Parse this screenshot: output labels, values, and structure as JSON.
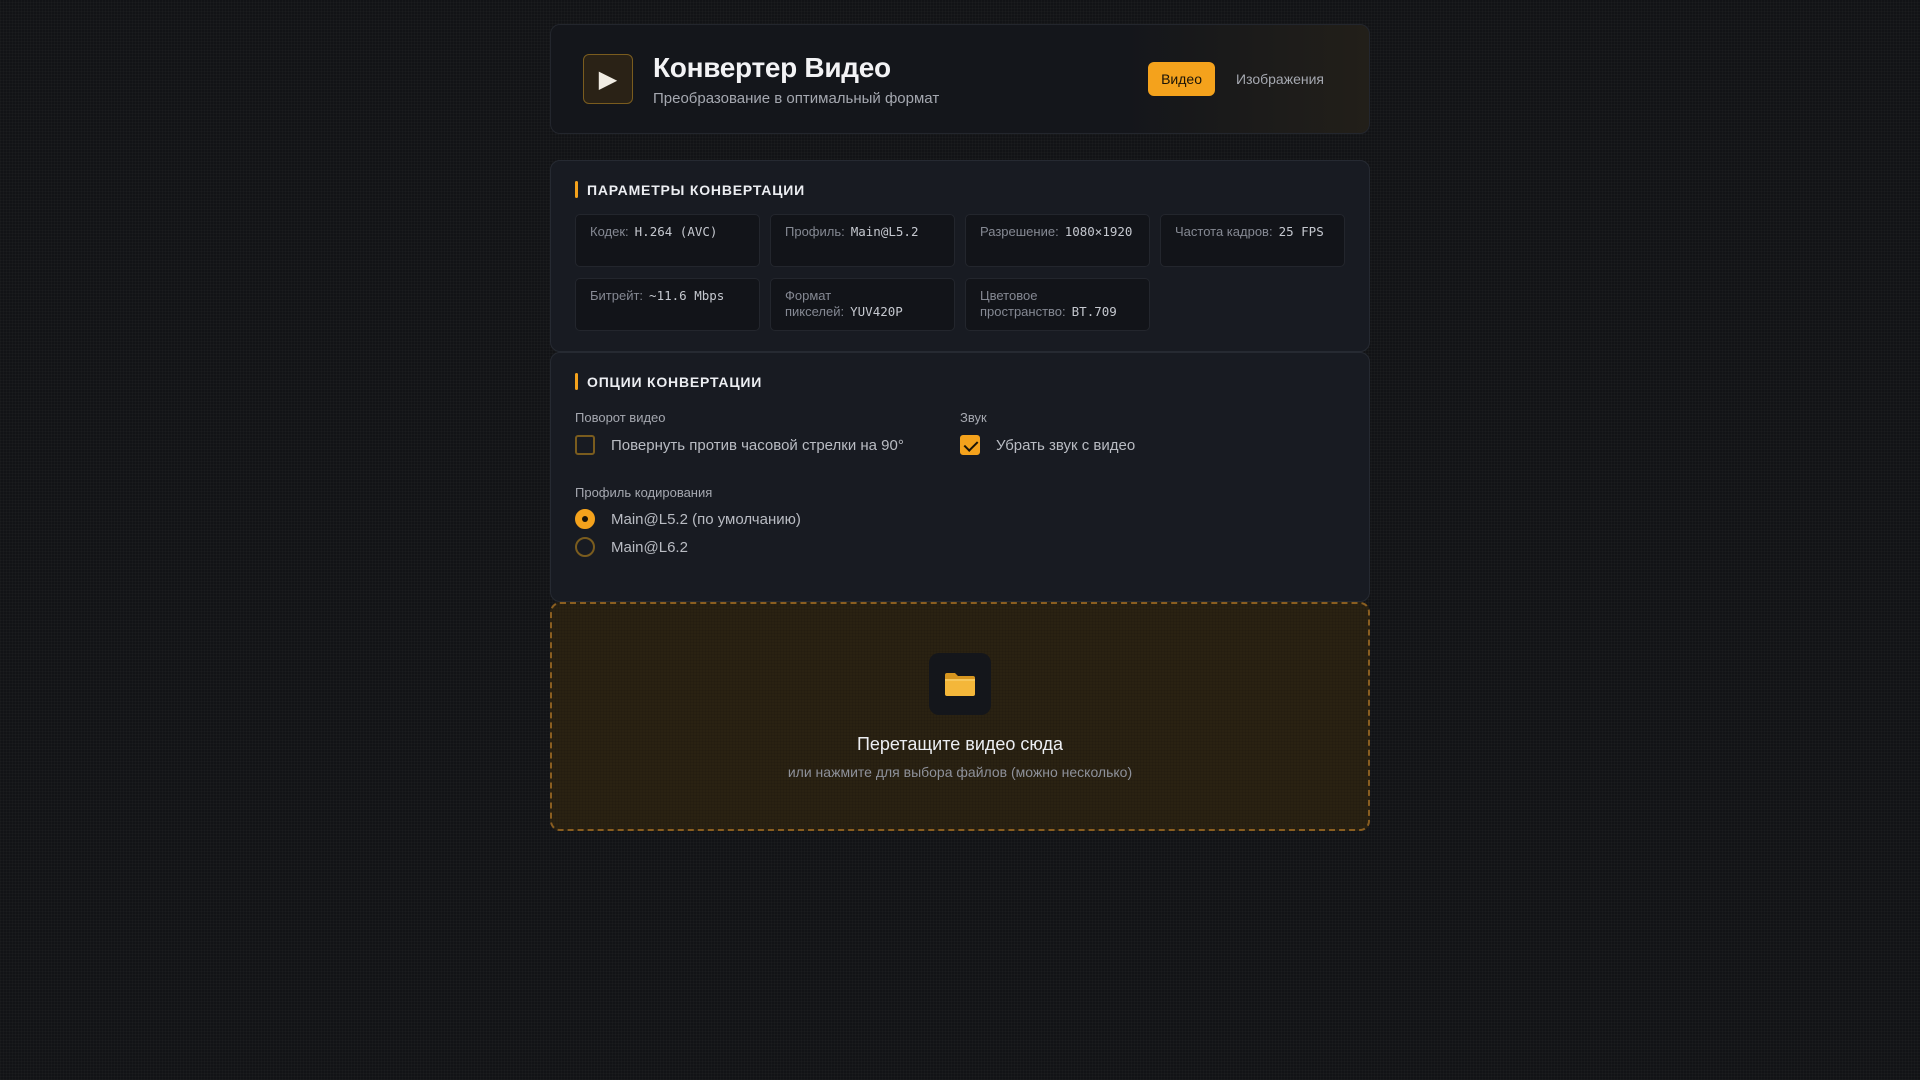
{
  "header": {
    "logo_glyph": "▶",
    "title": "Конвертер Видео",
    "subtitle": "Преобразование в оптимальный формат",
    "tabs": [
      {
        "label": "Видео",
        "active": true
      },
      {
        "label": "Изображения",
        "active": false
      }
    ]
  },
  "params": {
    "title": "ПАРАМЕТРЫ КОНВЕРТАЦИИ",
    "items": [
      {
        "label": "Кодек:",
        "value": "H.264 (AVC)"
      },
      {
        "label": "Профиль:",
        "value": "Main@L5.2"
      },
      {
        "label": "Разрешение:",
        "value": "1080×1920"
      },
      {
        "label": "Частота кадров:",
        "value": "25 FPS"
      },
      {
        "label": "Битрейт:",
        "value": "~11.6 Mbps"
      },
      {
        "label": "Формат пикселей:",
        "value": "YUV420P"
      },
      {
        "label": "Цветовое пространство:",
        "value": "BT.709"
      }
    ]
  },
  "options": {
    "title": "ОПЦИИ КОНВЕРТАЦИИ",
    "rotation": {
      "label": "Поворот видео",
      "checkbox_label": "Повернуть против часовой стрелки на 90°",
      "checked": false
    },
    "sound": {
      "label": "Звук",
      "checkbox_label": "Убрать звук с видео",
      "checked": true
    },
    "profile": {
      "label": "Профиль кодирования",
      "options": [
        {
          "label": "Main@L5.2 (по умолчанию)",
          "selected": true
        },
        {
          "label": "Main@L6.2",
          "selected": false
        }
      ]
    }
  },
  "dropzone": {
    "icon": "folder-icon",
    "title": "Перетащите видео сюда",
    "subtitle": "или нажмите для выбора файлов (можно несколько)"
  },
  "colors": {
    "accent": "#f4a21c",
    "background": "#121316",
    "panel": "#181b22"
  }
}
